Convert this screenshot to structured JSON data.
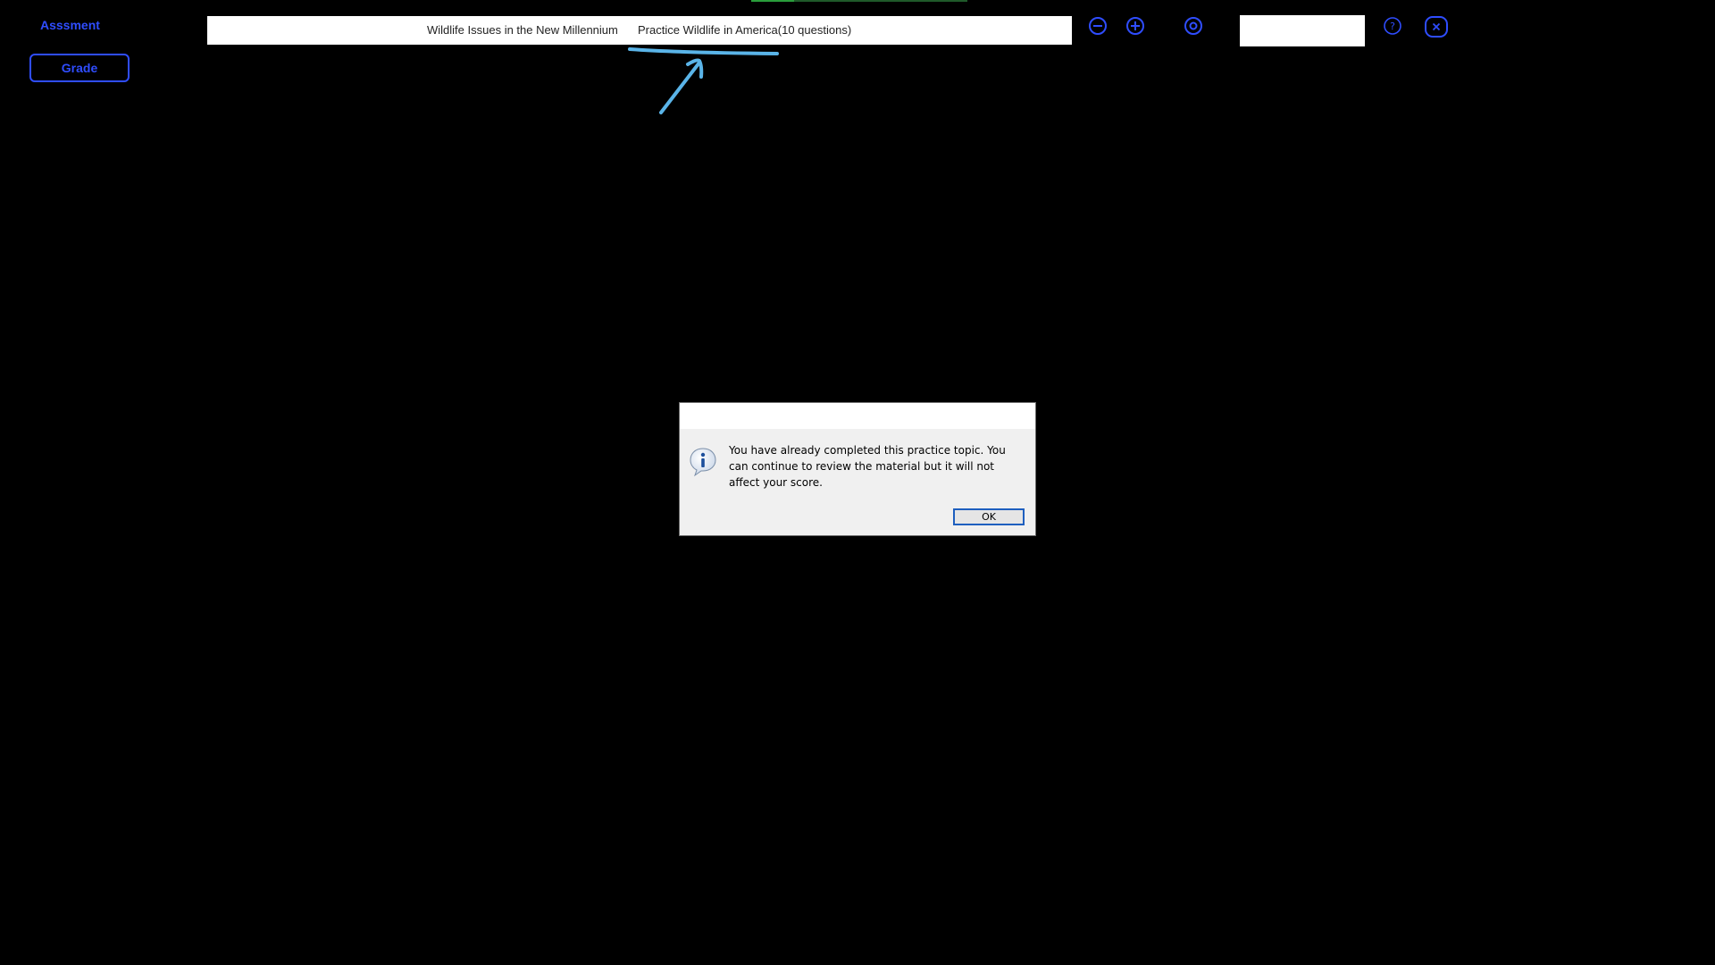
{
  "sidebar": {
    "assessment_label": "Asssment",
    "grade_label": "Grade"
  },
  "header": {
    "title": "Wildlife Issues in the New Millennium",
    "subtitle": "Practice Wildlife in America(10 questions)",
    "search_value": ""
  },
  "toolbar": {
    "icons": [
      "zoom-out-icon",
      "zoom-in-icon",
      "settings-target-icon",
      "help-icon",
      "close-icon"
    ]
  },
  "dialog": {
    "title": "",
    "message": "You have already completed this practice topic.  You can continue to review the material but it will not affect your score.",
    "ok_label": "OK",
    "icon": "info-icon"
  },
  "colors": {
    "background": "#000000",
    "accent_blue": "#2f4dff",
    "annotation_blue": "#5ab4e8",
    "dialog_bg": "#f0f0f0",
    "ok_border": "#1e5fbf"
  }
}
